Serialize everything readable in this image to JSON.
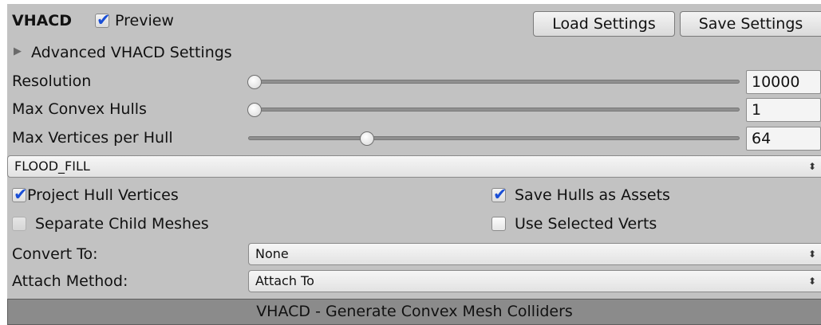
{
  "header": {
    "title": "VHACD",
    "preview_label": "Preview",
    "preview_checked": true,
    "load_settings": "Load Settings",
    "save_settings": "Save Settings"
  },
  "advanced": {
    "label": "Advanced VHACD Settings",
    "expanded": false
  },
  "sliders": [
    {
      "label": "Resolution",
      "value": "10000",
      "fraction": 0.0
    },
    {
      "label": "Max Convex Hulls",
      "value": "1",
      "fraction": 0.0
    },
    {
      "label": "Max Vertices per Hull",
      "value": "64",
      "fraction": 0.24
    }
  ],
  "mode_select": {
    "value": "FLOOD_FILL"
  },
  "options": {
    "project_hull_vertices": {
      "label": "Project Hull Vertices",
      "checked": true
    },
    "save_hulls_as_assets": {
      "label": "Save Hulls as Assets",
      "checked": true
    },
    "separate_child_meshes": {
      "label": "Separate Child Meshes",
      "checked": false,
      "disabled": true
    },
    "use_selected_verts": {
      "label": "Use Selected Verts",
      "checked": false
    }
  },
  "convert_to": {
    "label": "Convert To:",
    "value": "None"
  },
  "attach_method": {
    "label": "Attach Method:",
    "value": "Attach To"
  },
  "generate_button": "VHACD - Generate Convex Mesh Colliders",
  "colors": {
    "panel_bg": "#c2c2c2",
    "check_blue": "#1a4fd6",
    "generate_bg": "#8b8b8b"
  }
}
